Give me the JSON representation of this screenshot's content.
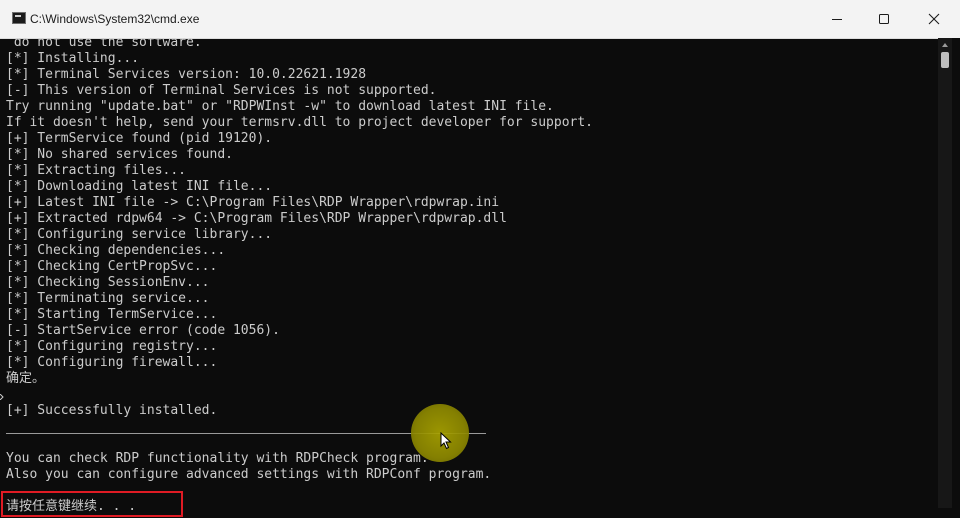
{
  "window": {
    "title": "C:\\Windows\\System32\\cmd.exe",
    "icon": "cmd-console-icon"
  },
  "controls": {
    "minimize_icon": "minimize-icon",
    "maximize_icon": "maximize-icon",
    "close_icon": "close-icon"
  },
  "console": {
    "lines": [
      " do not use the software.",
      "[*] Installing...",
      "[*] Terminal Services version: 10.0.22621.1928",
      "[-] This version of Terminal Services is not supported.",
      "Try running \"update.bat\" or \"RDPWInst -w\" to download latest INI file.",
      "If it doesn't help, send your termsrv.dll to project developer for support.",
      "[+] TermService found (pid 19120).",
      "[*] No shared services found.",
      "[*] Extracting files...",
      "[*] Downloading latest INI file...",
      "[+] Latest INI file -> C:\\Program Files\\RDP Wrapper\\rdpwrap.ini",
      "[+] Extracted rdpw64 -> C:\\Program Files\\RDP Wrapper\\rdpwrap.dll",
      "[*] Configuring service library...",
      "[*] Checking dependencies...",
      "[*] Checking CertPropSvc...",
      "[*] Checking SessionEnv...",
      "[*] Terminating service...",
      "[*] Starting TermService...",
      "[-] StartService error (code 1056).",
      "[*] Configuring registry...",
      "[*] Configuring firewall...",
      "确定。",
      "",
      "[+] Successfully installed.",
      "",
      "",
      "You can check RDP functionality with RDPCheck program.",
      "Also you can configure advanced settings with RDPConf program.",
      "",
      "请按任意键继续. . ."
    ]
  },
  "colors": {
    "console_bg": "#0c0c0c",
    "console_text": "#cccccc",
    "titlebar_bg": "#f3f3f3",
    "highlight_box": "#e01b24",
    "cursor_highlight": "#a8a200"
  }
}
